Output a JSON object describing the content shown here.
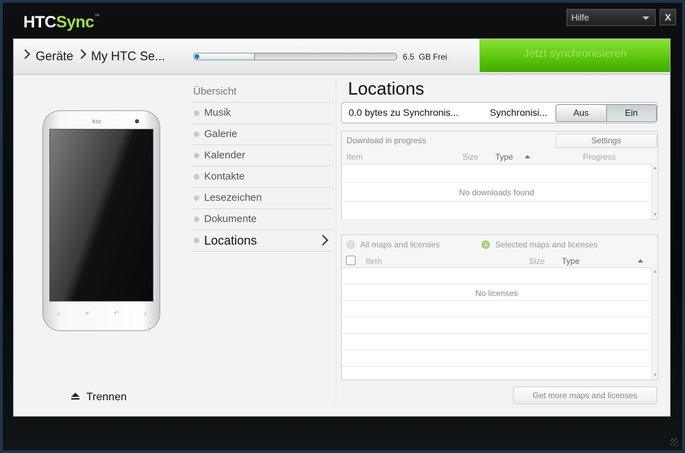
{
  "app": {
    "logo_htc": "HTC",
    "logo_sync": "Sync",
    "logo_tm": "™"
  },
  "header": {
    "help_label": "Hilfe",
    "close_label": "X"
  },
  "breadcrumb": {
    "devices": "Geräte",
    "device": "My HTC Se..."
  },
  "storage": {
    "free_value": "6.5",
    "free_unit": "GB Frei",
    "used_fraction": 0.3
  },
  "sync_button": {
    "label": "Jetzt synchronisieren"
  },
  "device": {
    "brand": "htc",
    "disconnect_label": "Trennen"
  },
  "nav": {
    "header": "Übersicht",
    "items": [
      "Musik",
      "Galerie",
      "Kalender",
      "Kontakte",
      "Lesezeichen",
      "Dokumente"
    ],
    "active": "Locations"
  },
  "main": {
    "title": "Locations",
    "bytes_status": "0.0  bytes zu Synchronis...",
    "sync_status": "Synchronisi...",
    "toggle_off": "Aus",
    "toggle_on": "Ein"
  },
  "downloads": {
    "header": "Download in progress",
    "settings_label": "Settings",
    "columns": [
      "Item",
      "Size",
      "Type",
      "Progress"
    ],
    "empty_message": "No downloads found"
  },
  "licenses": {
    "radio_all": "All maps and licenses",
    "radio_selected": "Selected maps and licenses",
    "selected": "selected",
    "columns": [
      "Item",
      "Size",
      "Type"
    ],
    "empty_message": "No licenses",
    "more_button": "Get more maps and licenses"
  },
  "colors": {
    "sync_green": "#5cc70d",
    "logo_green": "#9fe04a",
    "storage_knob": "#1d7fc4"
  }
}
